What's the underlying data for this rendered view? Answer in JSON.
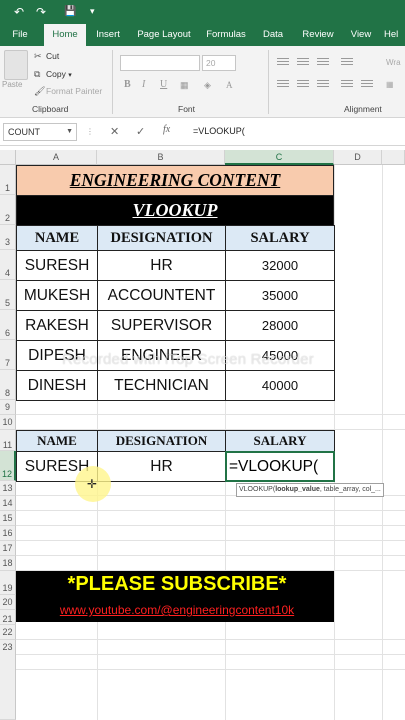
{
  "quick_access": {
    "undo_icon": "↶",
    "redo_icon": "↷",
    "save_icon": "💾"
  },
  "tabs": [
    "File",
    "Home",
    "Insert",
    "Page Layout",
    "Formulas",
    "Data",
    "Review",
    "View",
    "Hel"
  ],
  "ribbon": {
    "paste_label": "Paste",
    "cut_label": "Cut",
    "copy_label": "Copy",
    "format_painter_label": "Format Painter",
    "clipboard_group": "Clipboard",
    "font_group": "Font",
    "alignment_group": "Alignment",
    "font_size": "20",
    "bold": "B",
    "italic": "I",
    "underline": "U",
    "wrap_label": "Wra"
  },
  "formula_bar": {
    "name_box": "COUNT",
    "cancel_icon": "✕",
    "enter_icon": "✓",
    "fx_label": "fx",
    "formula": "=VLOOKUP("
  },
  "columns": [
    "A",
    "B",
    "C",
    "D"
  ],
  "rows": [
    "1",
    "2",
    "3",
    "4",
    "5",
    "6",
    "7",
    "8",
    "9",
    "10",
    "11",
    "12",
    "13",
    "14",
    "15",
    "16",
    "17",
    "18",
    "19",
    "20",
    "21",
    "22",
    "23"
  ],
  "sheet": {
    "title": "ENGINEERING CONTENT",
    "subtitle": "VLOOKUP",
    "headers": [
      "NAME",
      "DESIGNATION",
      "SALARY"
    ],
    "table": [
      [
        "SURESH",
        "HR",
        "32000"
      ],
      [
        "MUKESH",
        "ACCOUNTENT",
        "35000"
      ],
      [
        "RAKESH",
        "SUPERVISOR",
        "28000"
      ],
      [
        "DIPESH",
        "ENGINEER",
        "45000"
      ],
      [
        "DINESH",
        "TECHNICIAN",
        "40000"
      ]
    ],
    "lookup_headers": [
      "NAME",
      "DESIGNATION",
      "SALARY"
    ],
    "lookup_row": [
      "SURESH",
      "HR",
      "=VLOOKUP("
    ],
    "tooltip": {
      "fn": "VLOOKUP(",
      "arg1": "lookup_value",
      "rest": ", table_array, col_..."
    },
    "subscribe": "*PLEASE SUBSCRIBE*",
    "link": "www.youtube.com/@engineeringcontent10k"
  },
  "watermark": "Recorded with iTop Screen Recorder",
  "colors": {
    "excel_green": "#217346",
    "title_fill": "#f8cbad",
    "header_fill": "#dce9f5",
    "subscribe_text": "#ffff00",
    "link_text": "#ff2020"
  }
}
